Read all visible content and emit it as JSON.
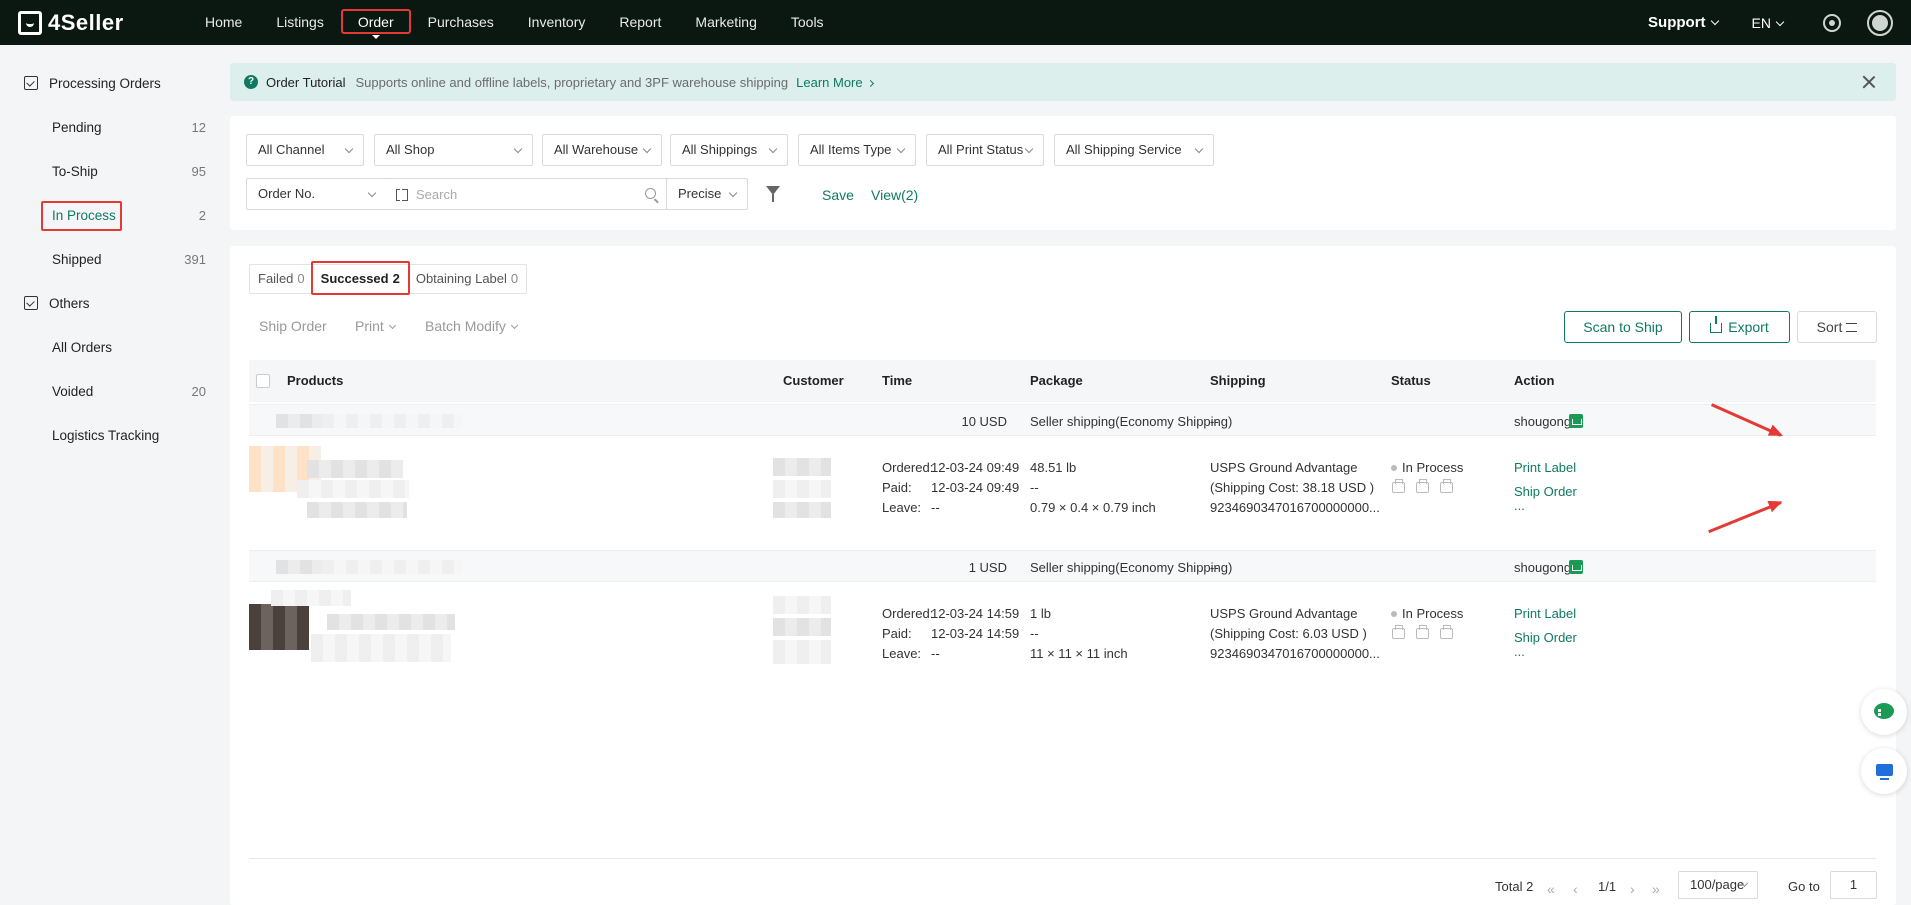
{
  "topbar": {
    "logo_text": "4Seller",
    "nav": [
      "Home",
      "Listings",
      "Order",
      "Purchases",
      "Inventory",
      "Report",
      "Marketing",
      "Tools"
    ],
    "support_label": "Support",
    "lang_label": "EN"
  },
  "sidebar": {
    "group1": "Processing Orders",
    "items1": [
      {
        "label": "Pending",
        "count": "12"
      },
      {
        "label": "To-Ship",
        "count": "95"
      },
      {
        "label": "In Process",
        "count": "2"
      },
      {
        "label": "Shipped",
        "count": "391"
      }
    ],
    "group2": "Others",
    "items2": [
      {
        "label": "All Orders",
        "count": ""
      },
      {
        "label": "Voided",
        "count": "20"
      },
      {
        "label": "Logistics Tracking",
        "count": ""
      }
    ]
  },
  "banner": {
    "title": "Order Tutorial",
    "desc": "Supports online and offline labels, proprietary and 3PF warehouse shipping",
    "link": "Learn More"
  },
  "filters": {
    "channel": "All Channel",
    "shop": "All Shop",
    "warehouse": "All Warehouse",
    "shippings": "All Shippings",
    "items_type": "All Items Type",
    "print_status": "All Print Status",
    "shipping_service": "All Shipping Service",
    "order_no": "Order No.",
    "search_placeholder": "Search",
    "precise": "Precise",
    "save": "Save",
    "view": "View(2)"
  },
  "tabs": [
    {
      "label": "Failed",
      "count": "0"
    },
    {
      "label": "Successed",
      "count": "2"
    },
    {
      "label": "Obtaining Label",
      "count": "0"
    }
  ],
  "toolbar": {
    "ship_order": "Ship Order",
    "print": "Print",
    "batch_modify": "Batch Modify",
    "scan_to_ship": "Scan to Ship",
    "export": "Export",
    "sort": "Sort"
  },
  "table": {
    "headers": {
      "products": "Products",
      "customer": "Customer",
      "time": "Time",
      "package": "Package",
      "shipping": "Shipping",
      "status": "Status",
      "action": "Action"
    },
    "orders": [
      {
        "amount": "10 USD",
        "seller_shipping": "Seller shipping(Economy Shipping)",
        "shipping_dash": "--",
        "shop": "shougong",
        "ordered_label": "Ordered:",
        "ordered": "12-03-24 09:49",
        "paid_label": "Paid:",
        "paid": "12-03-24 09:49",
        "leave_label": "Leave:",
        "leave": "--",
        "weight": "48.51 lb",
        "pkg_dash": "--",
        "dims": "0.79 × 0.4 × 0.79 inch",
        "carrier": "USPS Ground Advantage",
        "cost": "(Shipping Cost:  38.18 USD )",
        "tracking": "9234690347016700000000...",
        "status": "In Process",
        "print_label": "Print Label",
        "ship_order": "Ship Order",
        "more": "..."
      },
      {
        "amount": "1 USD",
        "seller_shipping": "Seller shipping(Economy Shipping)",
        "shipping_dash": "--",
        "shop": "shougong",
        "ordered_label": "Ordered:",
        "ordered": "12-03-24 14:59",
        "paid_label": "Paid:",
        "paid": "12-03-24 14:59",
        "leave_label": "Leave:",
        "leave": "--",
        "weight": "1 lb",
        "pkg_dash": "--",
        "dims": "11 × 11 × 11 inch",
        "carrier": "USPS Ground Advantage",
        "cost": "(Shipping Cost:  6.03 USD )",
        "tracking": "9234690347016700000000...",
        "status": "In Process",
        "print_label": "Print Label",
        "ship_order": "Ship Order",
        "more": "..."
      }
    ]
  },
  "pagination": {
    "total": "Total 2",
    "page": "1/1",
    "per_page": "100/page",
    "goto_label": "Go to",
    "goto_value": "1"
  },
  "colors": {
    "brand": "#0f7a61",
    "topbar": "#0b1812",
    "highlight": "#e53935"
  }
}
